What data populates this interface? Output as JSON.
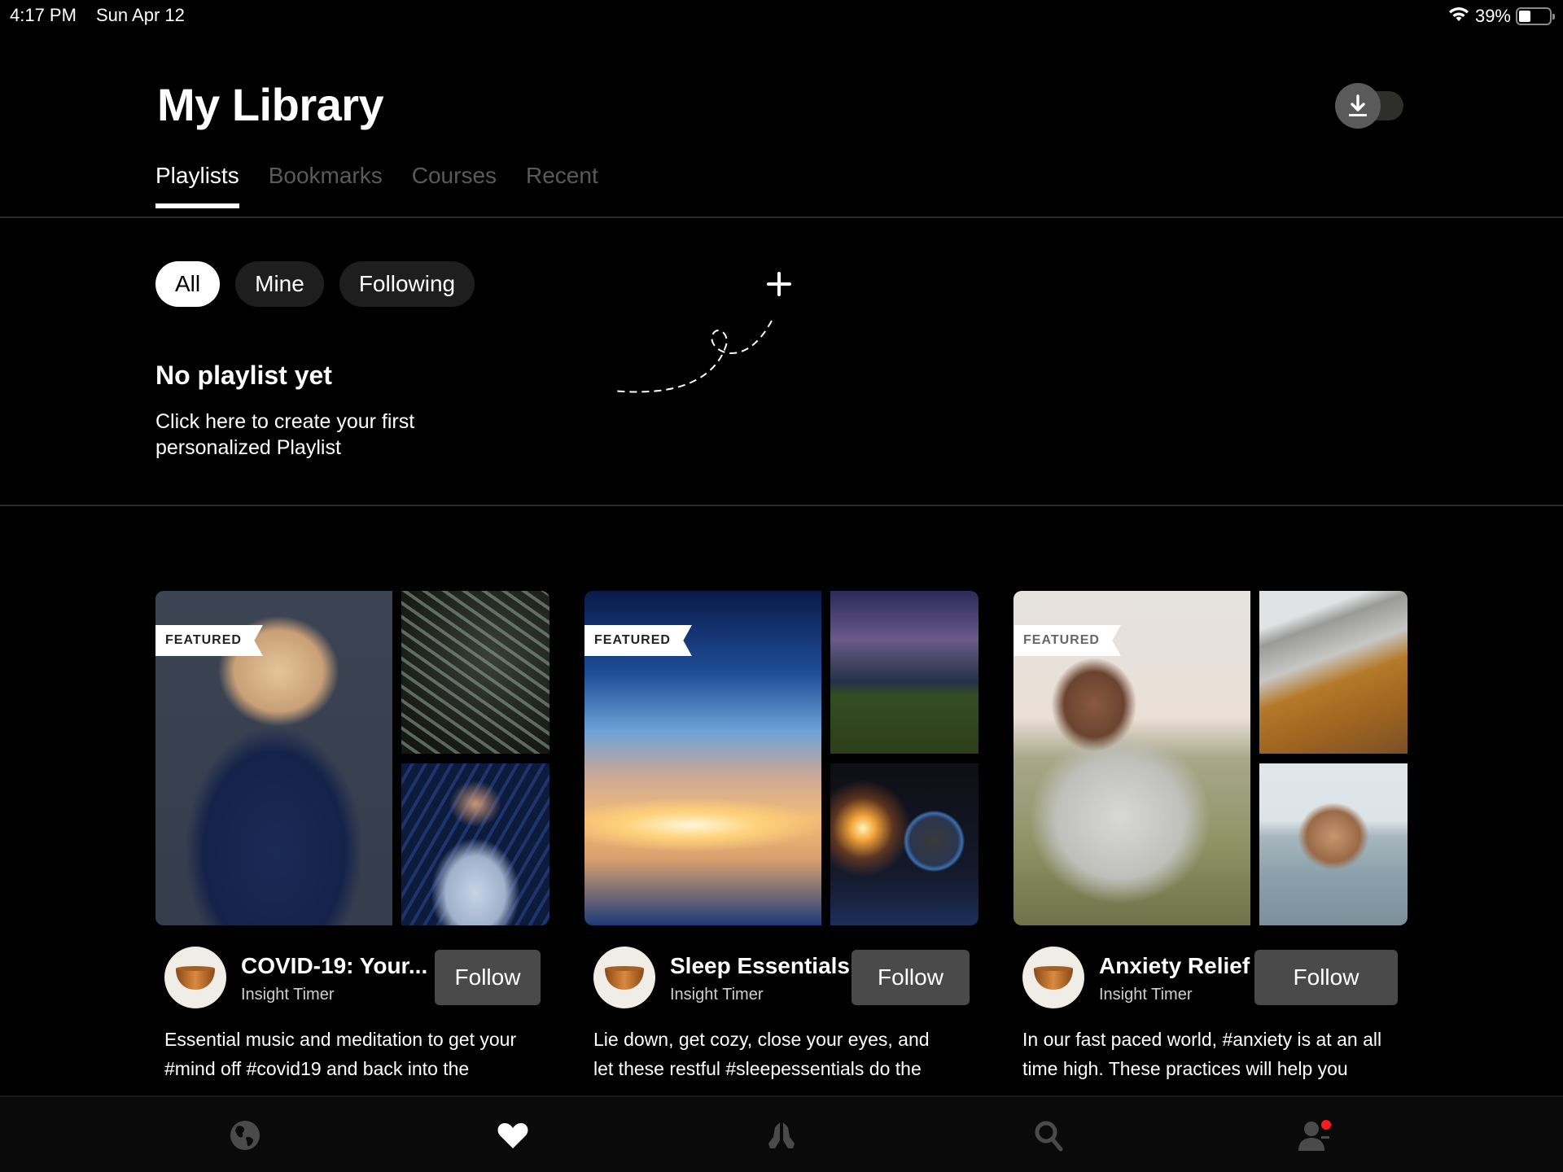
{
  "status_bar": {
    "time": "4:17 PM",
    "date": "Sun Apr 12",
    "battery": "39%",
    "battery_level": 0.39,
    "icons": [
      "wifi-icon",
      "battery-icon"
    ]
  },
  "header": {
    "title": "My Library",
    "download_toggle": {
      "icon": "download-icon",
      "on": false
    }
  },
  "tabs": [
    {
      "label": "Playlists",
      "active": true
    },
    {
      "label": "Bookmarks",
      "active": false
    },
    {
      "label": "Courses",
      "active": false
    },
    {
      "label": "Recent",
      "active": false
    }
  ],
  "filters": [
    {
      "label": "All",
      "active": true
    },
    {
      "label": "Mine",
      "active": false
    },
    {
      "label": "Following",
      "active": false
    }
  ],
  "empty_state": {
    "add_icon": "plus-icon",
    "title": "No playlist yet",
    "subtitle": "Click here to create your first personalized Playlist"
  },
  "featured_playlists": [
    {
      "badge": "FEATURED",
      "title": "COVID-19: Your...",
      "author": "Insight Timer",
      "follow_label": "Follow",
      "description_lines": [
        "Essential music and meditation to get your",
        "#mind off #covid19 and back into the"
      ],
      "images": [
        "woman-portrait",
        "fern-leaves",
        "speaker-on-stage"
      ]
    },
    {
      "badge": "FEATURED",
      "title": "Sleep Essentials",
      "author": "Insight Timer",
      "follow_label": "Follow",
      "description_lines": [
        "Lie down, get cozy, close your eyes, and",
        "let these restful #sleepessentials do the"
      ],
      "images": [
        "comet-sky-sunset",
        "milky-way-field",
        "sun-and-planet"
      ]
    },
    {
      "badge": "FEATURED",
      "title": "Anxiety Relief",
      "author": "Insight Timer",
      "follow_label": "Follow",
      "description_lines": [
        "In our fast paced world, #anxiety is at an all",
        "time high. These practices will help you"
      ],
      "images": [
        "man-in-grass",
        "mountain-autumn",
        "woman-in-water"
      ]
    }
  ],
  "bottom_nav": [
    {
      "name": "discover",
      "icon": "globe-icon",
      "active": false
    },
    {
      "name": "library",
      "icon": "heart-icon",
      "active": true
    },
    {
      "name": "meditate",
      "icon": "praying-hands-icon",
      "active": false
    },
    {
      "name": "search",
      "icon": "search-icon",
      "active": false
    },
    {
      "name": "profile",
      "icon": "profile-icon",
      "active": false,
      "notification": true
    }
  ],
  "colors": {
    "background": "#000000",
    "inactive_tab": "#5a5a5a",
    "chip_bg": "#1e1e1e",
    "follow_bg": "#4a4a4a",
    "nav_inactive": "#4a4a4a",
    "notification_dot": "#ff1a1a"
  }
}
